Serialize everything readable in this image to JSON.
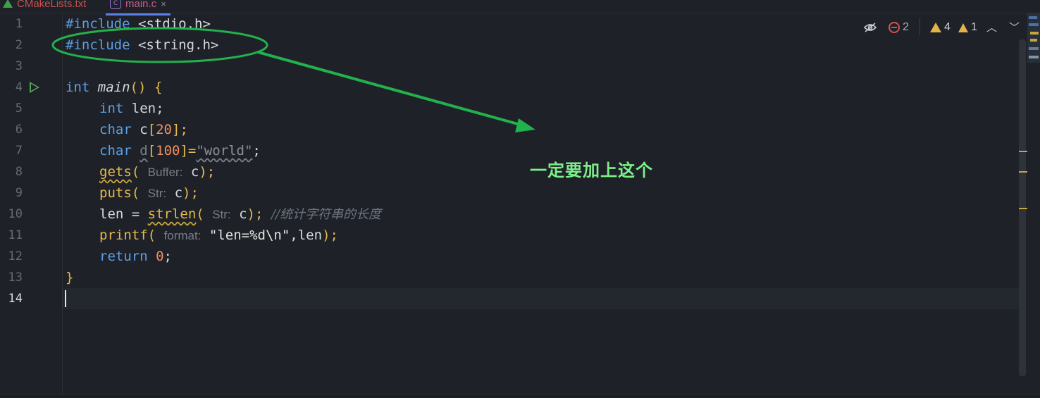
{
  "tabs": [
    {
      "label": "CMakeLists.txt"
    },
    {
      "label": "main.c",
      "close": "×"
    }
  ],
  "status": {
    "errors": "2",
    "warnings": "4",
    "weak_warnings": "1"
  },
  "line_numbers": [
    "1",
    "2",
    "3",
    "4",
    "5",
    "6",
    "7",
    "8",
    "9",
    "10",
    "11",
    "12",
    "13",
    "14"
  ],
  "code": {
    "l1_dir": "#include",
    "l1_hdr": " <stdio.h>",
    "l2_dir": "#include",
    "l2_hdr": " <string.h>",
    "l4_kw": "int",
    "l4_fn": "main",
    "l4_paren": "()",
    "l4_brace": "{",
    "l5_kw": "int",
    "l5_rest": " len;",
    "l6_kw": "char",
    "l6_var": " c",
    "l6_br1": "[",
    "l6_num": "20",
    "l6_br2": "];",
    "l7_kw": "char",
    "l7_var": "d",
    "l7_br1": "[",
    "l7_num": "100",
    "l7_br2": "]=",
    "l7_str": "\"world\"",
    "l7_end": ";",
    "l8_fn": "gets",
    "l8_p1": "(",
    "l8_hint": "Buffer:",
    "l8_arg": " c",
    "l8_p2": ");",
    "l9_fn": "puts",
    "l9_p1": "(",
    "l9_hint": "Str:",
    "l9_arg": " c",
    "l9_p2": ");",
    "l10_pre": "len = ",
    "l10_fn": "strlen",
    "l10_p1": "(",
    "l10_hint": "Str:",
    "l10_arg": " c",
    "l10_p2": ");",
    "l10_cmt": "//统计字符串的长度",
    "l11_fn": "printf",
    "l11_p1": "(",
    "l11_hint": "format:",
    "l11_str": "\"len=%d\\n\"",
    "l11_rest": ",len",
    "l11_p2": ");",
    "l12_kw": "return",
    "l12_num": "0",
    "l12_end": ";",
    "l13_brace": "}"
  },
  "annotation": {
    "text": "一定要加上这个",
    "color": "#7ef08a",
    "stroke": "#22b14c"
  },
  "colors": {
    "background": "#1e2228",
    "keyword": "#5d9ee6",
    "number": "#f08e62",
    "bracket": "#e5b94d",
    "warning": "#e2b347",
    "error": "#d25252"
  },
  "icons": [
    "cmake-icon",
    "c-file-icon",
    "run-icon",
    "hide-eye-icon",
    "error-icon",
    "warning-icon",
    "chevron-up-icon",
    "chevron-down-icon"
  ]
}
